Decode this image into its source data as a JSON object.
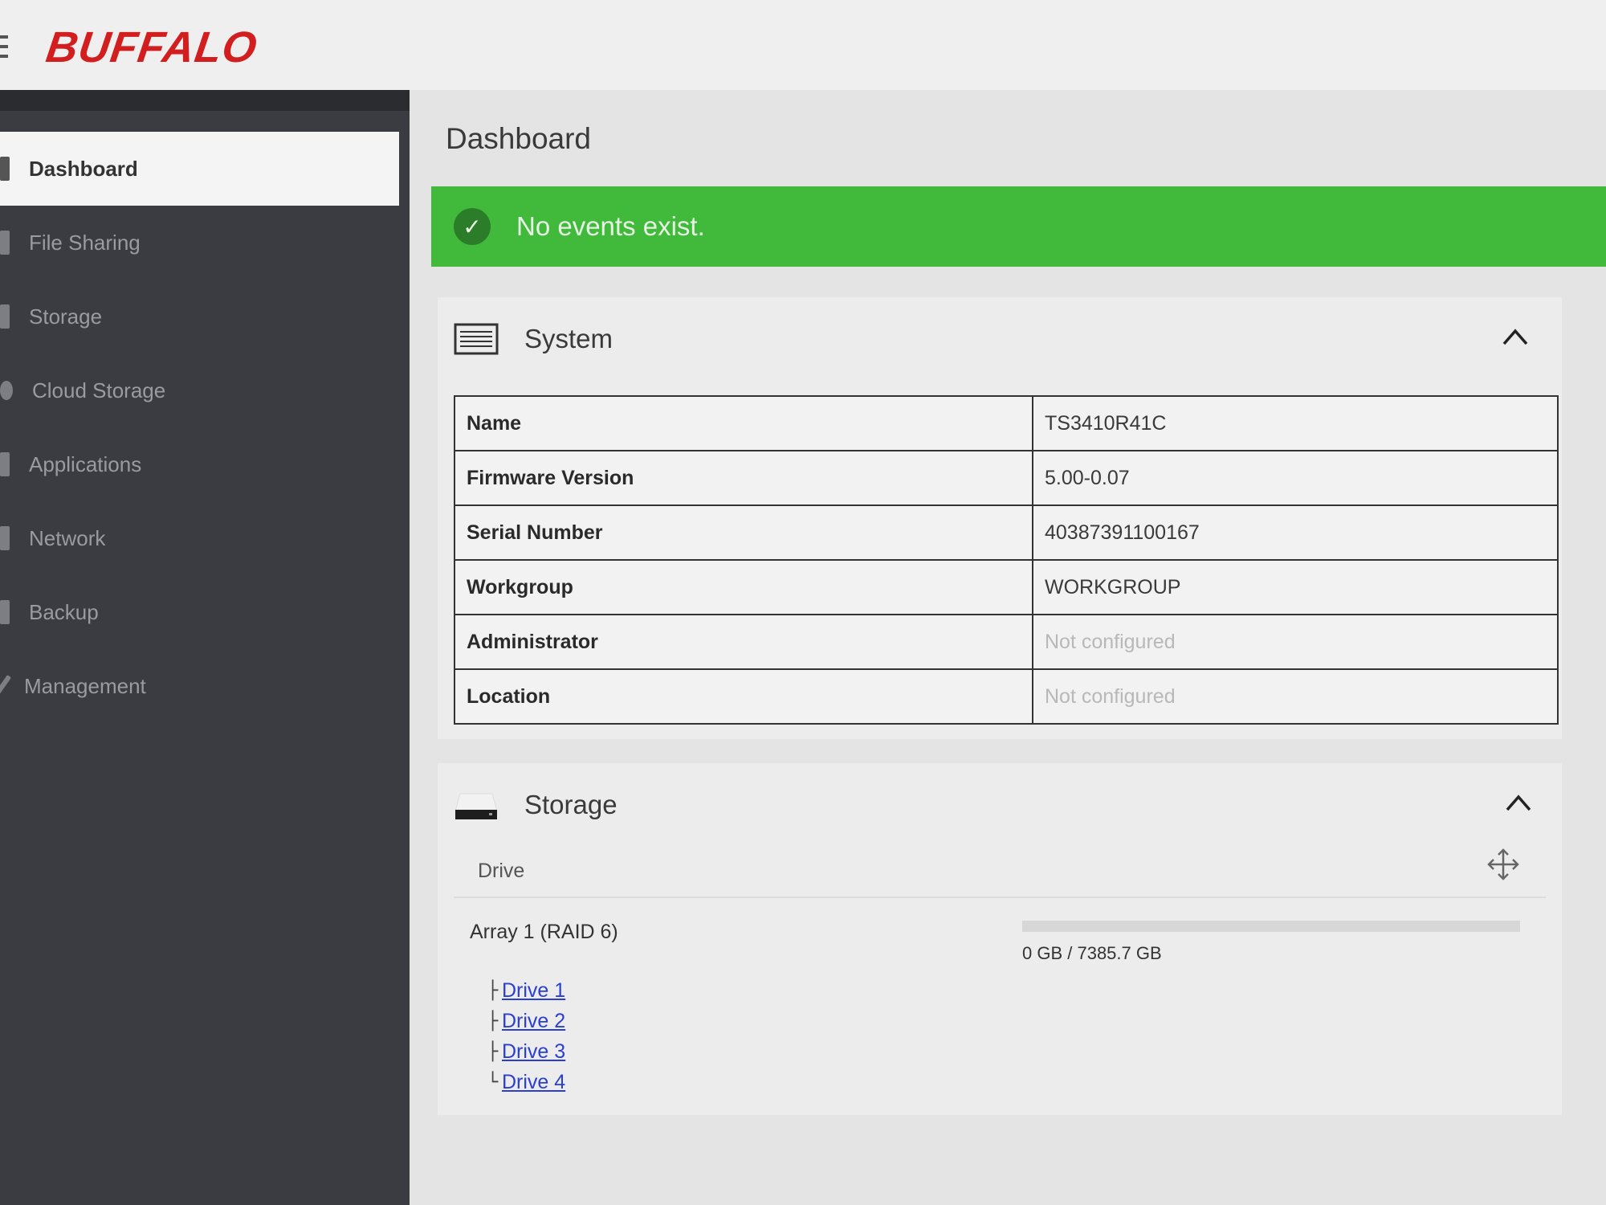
{
  "header": {
    "logo": "BUFFALO"
  },
  "sidebar": {
    "items": [
      {
        "label": "Dashboard",
        "icon": "dashboard-icon",
        "active": true
      },
      {
        "label": "File Sharing",
        "icon": "file-sharing-icon",
        "active": false
      },
      {
        "label": "Storage",
        "icon": "storage-icon",
        "active": false
      },
      {
        "label": "Cloud Storage",
        "icon": "cloud-storage-icon",
        "active": false
      },
      {
        "label": "Applications",
        "icon": "applications-icon",
        "active": false
      },
      {
        "label": "Network",
        "icon": "network-icon",
        "active": false
      },
      {
        "label": "Backup",
        "icon": "backup-icon",
        "active": false
      },
      {
        "label": "Management",
        "icon": "management-icon",
        "active": false
      }
    ]
  },
  "main": {
    "title": "Dashboard",
    "alert": {
      "text": "No events exist.",
      "icon": "check-circle-icon",
      "color": "#41b93a"
    },
    "system": {
      "title": "System",
      "rows": [
        {
          "key": "Name",
          "value": "TS3410R41C",
          "muted": false
        },
        {
          "key": "Firmware Version",
          "value": "5.00-0.07",
          "muted": false
        },
        {
          "key": "Serial Number",
          "value": "40387391100167",
          "muted": false
        },
        {
          "key": "Workgroup",
          "value": "WORKGROUP",
          "muted": false
        },
        {
          "key": "Administrator",
          "value": "Not configured",
          "muted": true
        },
        {
          "key": "Location",
          "value": "Not configured",
          "muted": true
        }
      ]
    },
    "storage": {
      "title": "Storage",
      "drive_heading": "Drive",
      "array_label": "Array 1 (RAID 6)",
      "usage_text": "0 GB / 7385.7 GB",
      "usage_fraction": 0,
      "drives": [
        {
          "tree": "├",
          "label": "Drive 1"
        },
        {
          "tree": "├",
          "label": "Drive 2"
        },
        {
          "tree": "├",
          "label": "Drive 3"
        },
        {
          "tree": "└",
          "label": "Drive 4"
        }
      ]
    }
  }
}
